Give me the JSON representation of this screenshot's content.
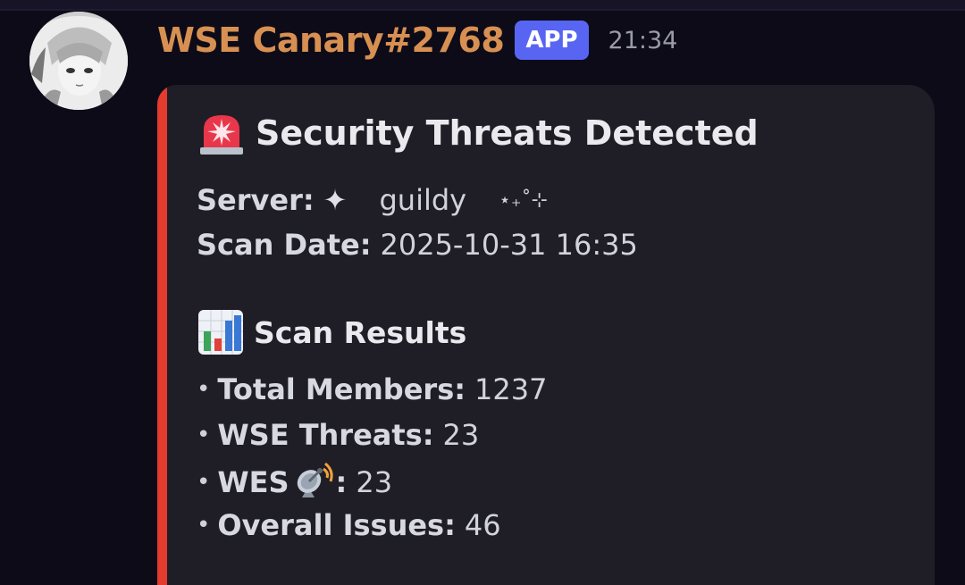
{
  "message": {
    "username": "WSE Canary#2768",
    "badge": "APP",
    "time": "21:34"
  },
  "embed": {
    "accent_color": "#e33b2e",
    "title_icon": "police-light-icon",
    "title": "Security Threats Detected",
    "server_label": "Server:",
    "server_sparkle": "✦",
    "server_name": "guildy",
    "server_trail": "⋆₊˚⊹",
    "scan_date_label": "Scan Date:",
    "scan_date_value": "2025-10-31 16:35",
    "results_icon": "bar-chart-icon",
    "results_title": "Scan Results",
    "bullet": "•",
    "stats": {
      "total_members_label": "Total Members:",
      "total_members_value": "1237",
      "wse_threats_label": "WSE Threats:",
      "wse_threats_value": "23",
      "wes_label": "WES",
      "wes_icon": "satellite-antenna-icon",
      "wes_colon": ":",
      "wes_value": "23",
      "overall_label": "Overall Issues:",
      "overall_value": "46"
    }
  }
}
